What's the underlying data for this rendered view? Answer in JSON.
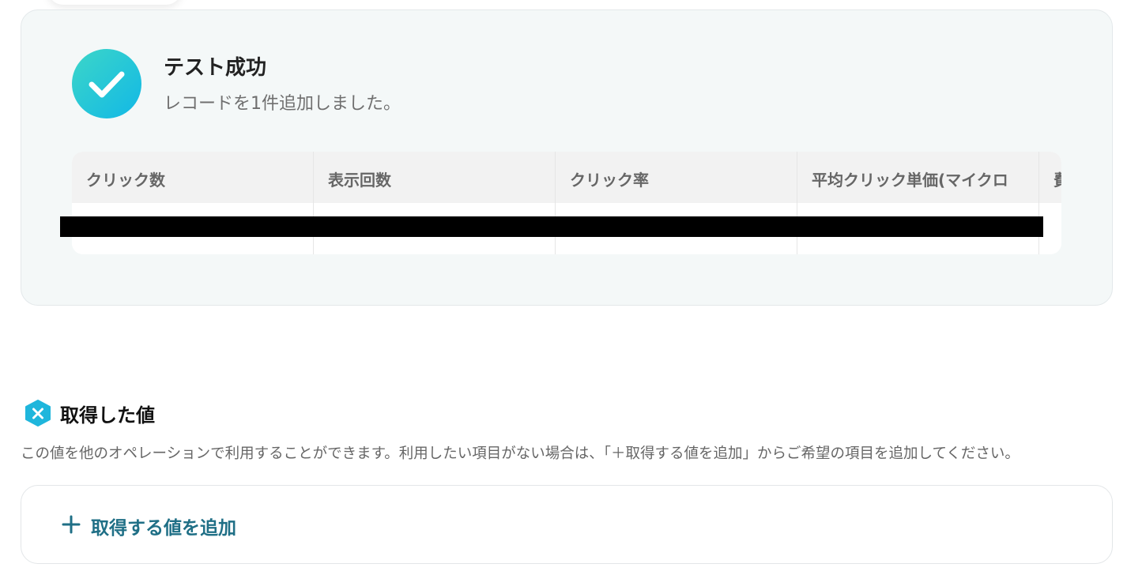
{
  "test_result": {
    "title": "テスト成功",
    "subtitle": "レコードを1件追加しました。",
    "columns": [
      "クリック数",
      "表示回数",
      "クリック率",
      "平均クリック単価(マイクロ",
      "費"
    ]
  },
  "fetched_values": {
    "title": "取得した値",
    "description": "この値を他のオペレーションで利用することができます。利用したい項目がない場合は、「＋取得する値を追加」からご希望の項目を追加してください。",
    "add_button_label": "取得する値を追加"
  },
  "colors": {
    "accent": "#1f6f86",
    "success_gradient_start": "#3cd6c8",
    "success_gradient_end": "#12b8e6",
    "card_bg": "#f4f8f8"
  }
}
